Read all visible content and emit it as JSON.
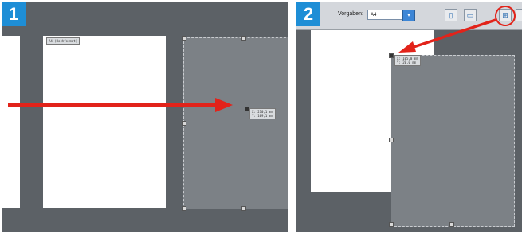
{
  "panel1": {
    "step_number": "1",
    "page_tag": "A4 (Hochformat)",
    "coord_readout": "X: 210,1 mm\nY: 109,1 mm"
  },
  "panel2": {
    "step_number": "2",
    "toolbar": {
      "label": "Vorgaben:",
      "preset_value": "A4"
    },
    "coord_readout": "X: 105,0 mm\nY: 20,0 mm"
  },
  "colors": {
    "step_badge": "#1e8ed6",
    "annotation_red": "#e2231a",
    "canvas_gray": "#5c6166"
  }
}
